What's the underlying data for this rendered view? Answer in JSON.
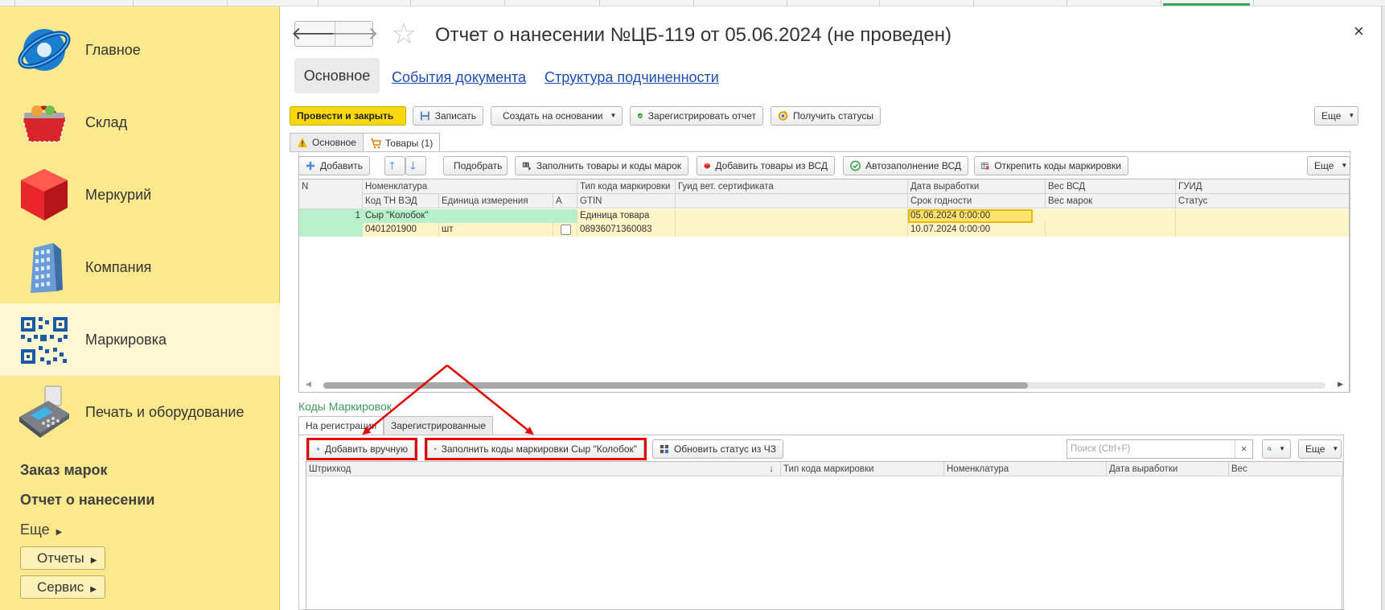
{
  "sidebar": {
    "items": [
      {
        "label": "Главное",
        "icon": "globe-icon"
      },
      {
        "label": "Склад",
        "icon": "basket-icon"
      },
      {
        "label": "Меркурий",
        "icon": "cube-icon"
      },
      {
        "label": "Компания",
        "icon": "building-icon"
      },
      {
        "label": "Маркировка",
        "icon": "qr-code-icon"
      },
      {
        "label": "Печать и оборудование",
        "icon": "card-terminal-icon"
      }
    ],
    "sub_items": [
      "Заказ марок",
      "Отчет о нанесении"
    ],
    "more_label": "Еще",
    "buttons": [
      "Отчеты",
      "Сервис"
    ]
  },
  "document": {
    "title": "Отчет о нанесении №ЦБ-119 от 05.06.2024 (не проведен)",
    "back_arrow": "🡐",
    "forward_arrow": "🡒",
    "close_symbol": "×",
    "tabs": [
      "Основное",
      "События документа",
      "Структура подчиненности"
    ]
  },
  "toolbar": {
    "post_close": "Провести и закрыть",
    "save": "Записать",
    "create_based": "Создать на основании",
    "register_report": "Зарегистрировать отчет",
    "get_statuses": "Получить статусы",
    "more": "Еще"
  },
  "form_tabs": [
    "Основное",
    "Товары (1)"
  ],
  "goods_toolbar": {
    "add": "Добавить",
    "pick": "Подобрать",
    "fill_goods": "Заполнить товары и коды марок",
    "add_from_vsd": "Добавить товары из ВСД",
    "autofill_vsd": "Автозаполнение ВСД",
    "unpin_codes": "Открепить коды маркировки",
    "more": "Еще"
  },
  "goods_table": {
    "headers_row1": [
      "N",
      "Номенклатура",
      "Тип кода маркировки",
      "Гуид вет. сертификата",
      "Дата выработки",
      "Вес ВСД",
      "ГУИД"
    ],
    "headers_row2": [
      "Код ТН ВЭД",
      "Единица измерения",
      "А",
      "GTIN",
      "Срок годности",
      "Вес марок",
      "Статус"
    ],
    "rows": [
      {
        "n": "1",
        "nomenclature": "Сыр \"Колобок\"",
        "code_type": "Единица товара",
        "production_date": "05.06.2024 0:00:00",
        "tnved": "0401201900",
        "unit": "шт",
        "gtin": "08936071360083",
        "expiry": "10.07.2024 0:00:00"
      }
    ]
  },
  "codes": {
    "title": "Коды Маркировок",
    "tabs": [
      "На регистрации",
      "Зарегистрированные"
    ],
    "add_manual": "Добавить вручную",
    "fill_codes": "Заполнить коды маркировки Сыр \"Колобок\"",
    "update_status": "Обновить статус из ЧЗ",
    "search_placeholder": "Поиск (Ctrl+F)",
    "more": "Еще",
    "headers": [
      "Штрихкод",
      "Тип кода маркировки",
      "Номенклатура",
      "Дата выработки",
      "Вес"
    ],
    "sort_arrow": "↓"
  },
  "colors": {
    "sidebar_bg": "#fce98e",
    "primary_button": "#f7d80d",
    "link": "#1c4fb4",
    "highlight_red": "#e10000",
    "row_selected": "#b8f0cc"
  }
}
